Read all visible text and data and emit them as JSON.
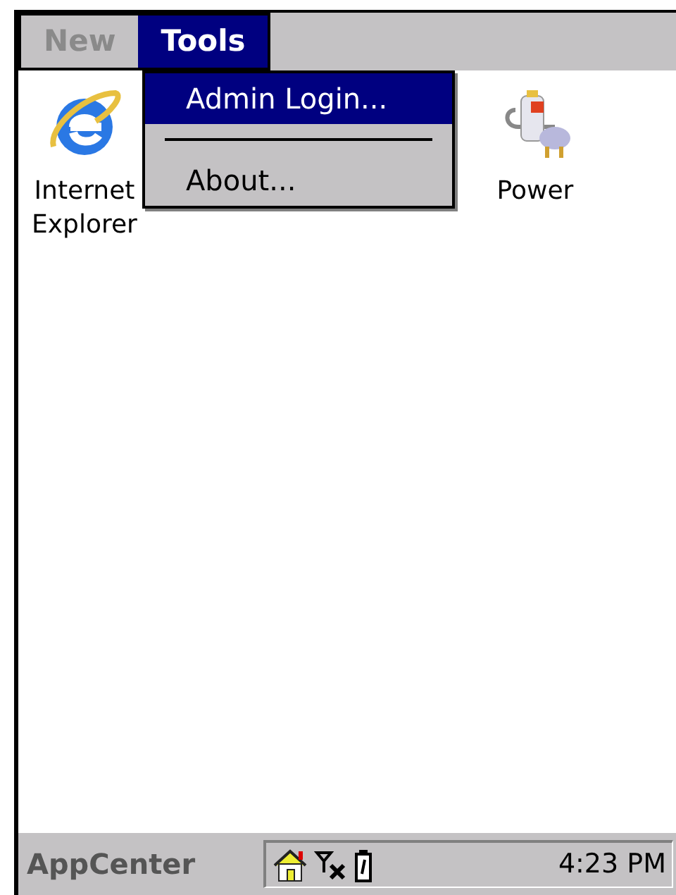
{
  "menu_bar": [
    {
      "label": "New",
      "selected": false,
      "disabled": true
    },
    {
      "label": "Tools",
      "selected": true,
      "disabled": false
    }
  ],
  "dropdown": [
    {
      "kind": "item",
      "label": "Admin Login...",
      "selected": true
    },
    {
      "kind": "separator"
    },
    {
      "kind": "item",
      "label": "About...",
      "selected": false
    }
  ],
  "desktop_icons": [
    {
      "kind": "browser",
      "label": "Internet Explorer"
    },
    {
      "kind": "power",
      "label": "Power"
    }
  ],
  "taskbar": {
    "app_name": "AppCenter",
    "clock": "4:23 PM"
  }
}
